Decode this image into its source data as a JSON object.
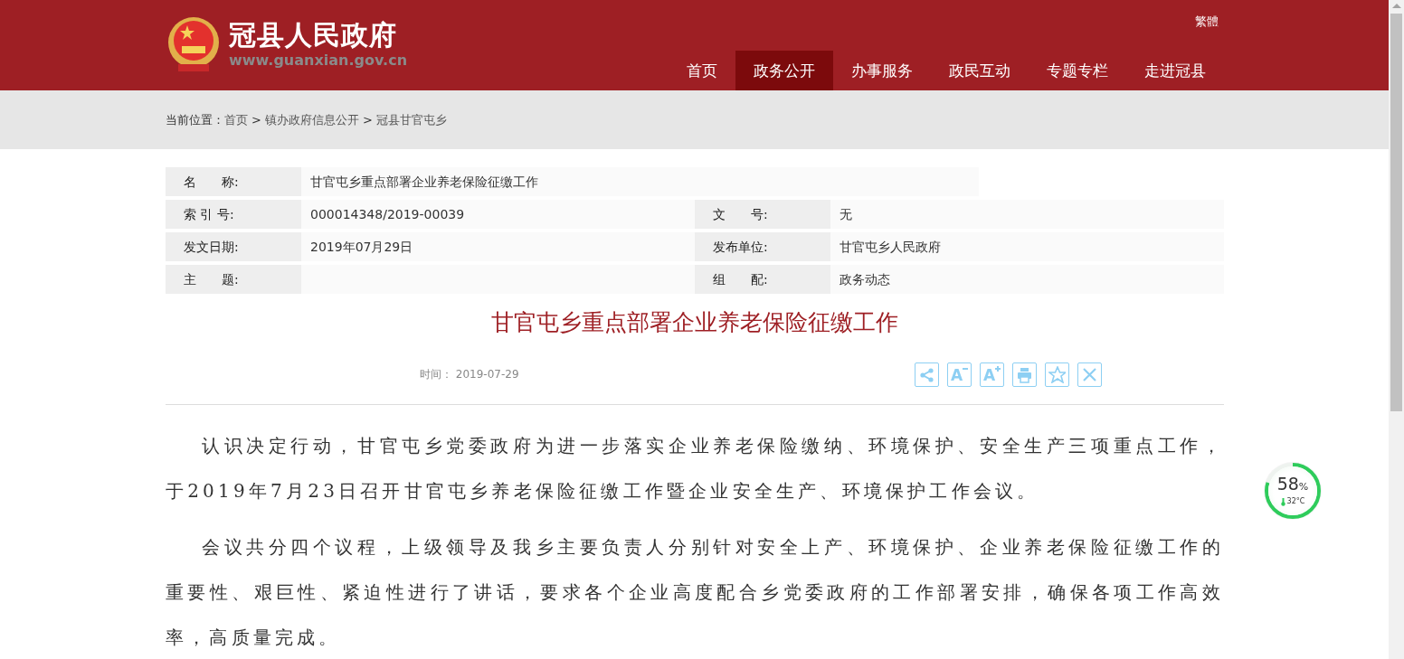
{
  "header": {
    "site_name": "冠县人民政府",
    "site_url": "www.guanxian.gov.cn",
    "language_link": "繁體",
    "nav": [
      {
        "label": "首页",
        "selected": false
      },
      {
        "label": "政务公开",
        "selected": true
      },
      {
        "label": "办事服务",
        "selected": false
      },
      {
        "label": "政民互动",
        "selected": false
      },
      {
        "label": "专题专栏",
        "selected": false
      },
      {
        "label": "走进冠县",
        "selected": false
      }
    ]
  },
  "breadcrumb": {
    "label": "当前位置：",
    "items": [
      "首页",
      "镇办政府信息公开",
      "冠县甘官屯乡"
    ],
    "separator": ">"
  },
  "info_table": {
    "rows": [
      [
        {
          "label": "名　　称:",
          "value": "甘官屯乡重点部署企业养老保险征缴工作"
        }
      ],
      [
        {
          "label": "索 引 号:",
          "value": "000014348/2019-00039"
        },
        {
          "label": "文　　号:",
          "value": "无"
        }
      ],
      [
        {
          "label": "发文日期:",
          "value": "2019年07月29日"
        },
        {
          "label": "发布单位:",
          "value": "甘官屯乡人民政府"
        }
      ],
      [
        {
          "label": "主　　题:"
        },
        {
          "label": "组　　配:",
          "value": "政务动态"
        }
      ]
    ]
  },
  "article": {
    "title": "甘官屯乡重点部署企业养老保险征缴工作",
    "time": "时间： 2019-07-29",
    "tools": [
      {
        "kind": "share"
      },
      {
        "kind": "font-smaller",
        "label": "A"
      },
      {
        "kind": "font-larger",
        "label": "A"
      },
      {
        "kind": "print"
      },
      {
        "kind": "favorite"
      },
      {
        "kind": "close"
      }
    ],
    "paragraphs": [
      "认识决定行动，甘官屯乡党委政府为进一步落实企业养老保险缴纳、环境保护、安全生产三项重点工作，于2019年7月23日召开甘官屯乡养老保险征缴工作暨企业安全生产、环境保护工作会议。",
      "会议共分四个议程，上级领导及我乡主要负责人分别针对安全上产、环境保护、企业养老保险征缴工作的重要性、艰巨性、紧迫性进行了讲话，要求各个企业高度配合乡党委政府的工作部署安排，确保各项工作高效率，高质量完成。"
    ]
  },
  "widget": {
    "value": "58",
    "unit": "%",
    "temperature": "32°C",
    "level": 0.8
  }
}
